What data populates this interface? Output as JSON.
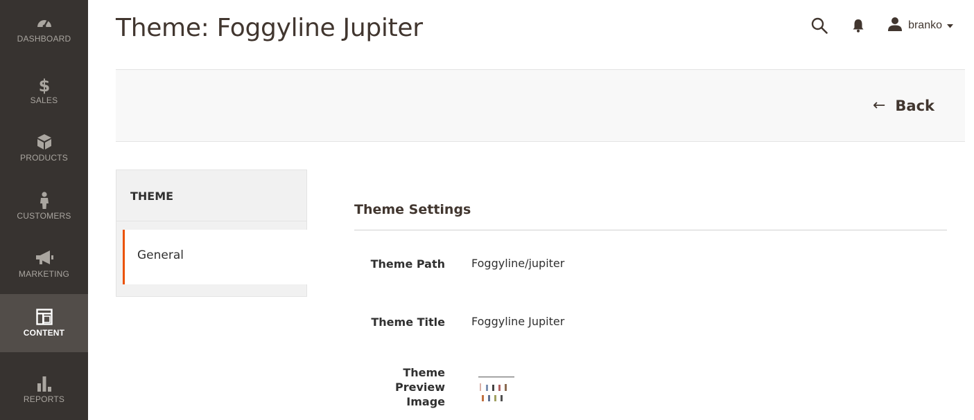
{
  "sidebar": {
    "items": [
      {
        "label": "DASHBOARD",
        "icon": "speedometer-icon"
      },
      {
        "label": "SALES",
        "icon": "dollar-icon"
      },
      {
        "label": "PRODUCTS",
        "icon": "cube-icon"
      },
      {
        "label": "CUSTOMERS",
        "icon": "person-icon"
      },
      {
        "label": "MARKETING",
        "icon": "megaphone-icon"
      },
      {
        "label": "CONTENT",
        "icon": "layout-icon"
      },
      {
        "label": "REPORTS",
        "icon": "bar-chart-icon"
      }
    ],
    "active": "CONTENT"
  },
  "header": {
    "title": "Theme: Foggyline Jupiter",
    "user_name": "branko"
  },
  "action_bar": {
    "back_label": "Back"
  },
  "tabs": {
    "title": "THEME",
    "items": [
      {
        "label": "General",
        "active": true
      }
    ]
  },
  "settings": {
    "section_title": "Theme Settings",
    "fields": {
      "path": {
        "label": "Theme Path",
        "value": "Foggyline/jupiter"
      },
      "title": {
        "label": "Theme Title",
        "value": "Foggyline Jupiter"
      },
      "preview": {
        "label_line1": "Theme",
        "label_line2": "Preview",
        "label_line3": "Image"
      }
    }
  },
  "colors": {
    "sidebar_bg": "#373330",
    "sidebar_active_bg": "#524d49",
    "accent": "#eb5202",
    "text": "#303030",
    "heading": "#41362f"
  }
}
